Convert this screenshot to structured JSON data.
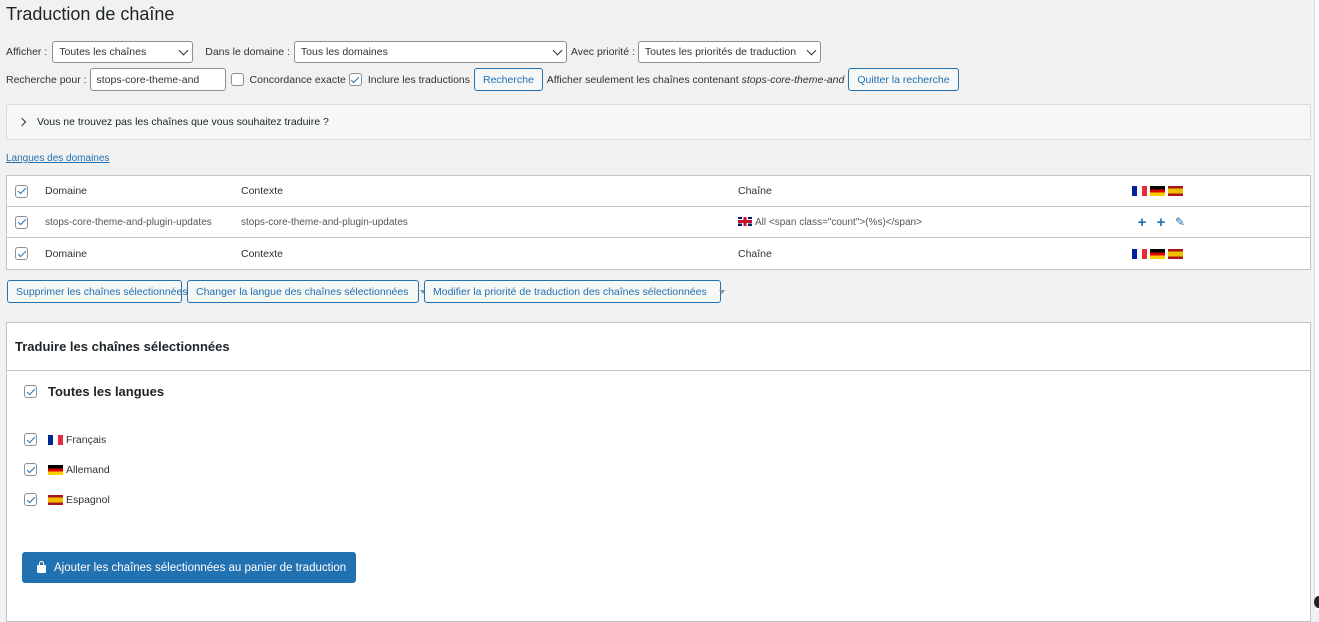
{
  "page_title": "Traduction de chaîne",
  "filters": {
    "show_label": "Afficher :",
    "show_value": "Toutes les chaînes",
    "domain_label": "Dans le domaine :",
    "domain_value": "Tous les domaines",
    "priority_label": "Avec priorité :",
    "priority_value": "Toutes les priorités de traduction"
  },
  "search": {
    "label": "Recherche pour :",
    "value": "stops-core-theme-and",
    "exact_match_label": "Concordance exacte",
    "exact_match_checked": false,
    "include_translations_label": "Inclure les traductions",
    "include_translations_checked": true,
    "search_button": "Recherche",
    "info_prefix": "Afficher seulement les chaînes contenant",
    "info_term": "stops-core-theme-and",
    "quit_button": "Quitter la recherche"
  },
  "notice": "Vous ne trouvez pas les chaînes que vous souhaitez traduire ?",
  "domains_link": "Langues des domaines",
  "table": {
    "header": {
      "domain": "Domaine",
      "context": "Contexte",
      "string": "Chaîne"
    },
    "rows": [
      {
        "domain": "stops-core-theme-and-plugin-updates",
        "context": "stops-core-theme-and-plugin-updates",
        "string": "All <span class=\"count\">(%s)</span>"
      }
    ],
    "footer": {
      "domain": "Domaine",
      "context": "Contexte",
      "string": "Chaîne"
    },
    "languages": [
      "fr-flag-icon",
      "de-flag-icon",
      "es-flag-icon"
    ]
  },
  "bulk_actions": {
    "delete": "Supprimer les chaînes sélectionnées",
    "change_language": "Changer la langue des chaînes sélectionnées",
    "change_priority": "Modifier la priorité de traduction des chaînes sélectionnées"
  },
  "translate_panel": {
    "title": "Traduire les chaînes sélectionnées",
    "all_languages": "Toutes les langues",
    "languages": [
      {
        "name": "Français",
        "flag": "fr-flag-icon",
        "checked": true
      },
      {
        "name": "Allemand",
        "flag": "de-flag-icon",
        "checked": true
      },
      {
        "name": "Espagnol",
        "flag": "es-flag-icon",
        "checked": true
      }
    ],
    "add_button": "Ajouter les chaînes sélectionnées au panier de traduction"
  },
  "colors": {
    "accent": "#2271b1",
    "background": "#f1f1f1",
    "border": "#c3c4c7"
  }
}
